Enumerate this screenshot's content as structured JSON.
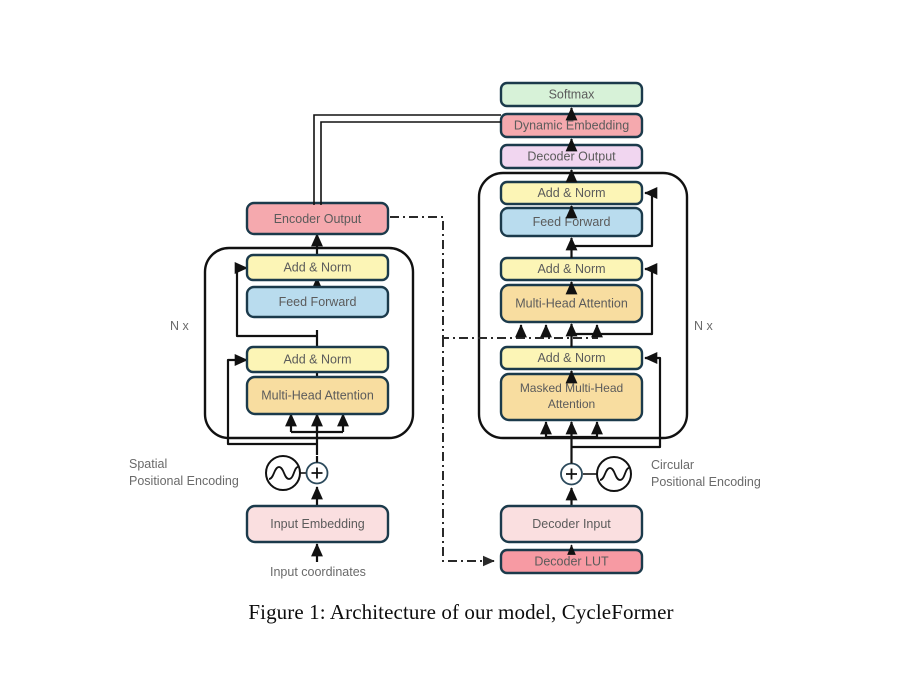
{
  "figure": {
    "caption": "Figure 1: Architecture of our model, CycleFormer"
  },
  "colors": {
    "softmax": "#d7f2d8",
    "dynamic_embedding": "#f5a9ae",
    "decoder_output": "#f1d6f0",
    "add_norm": "#fcf5b6",
    "feed_forward": "#b9dcee",
    "attention": "#f8dda0",
    "encoder_output": "#f5a9ae",
    "decoder_lut": "#f79aa3",
    "input_embedding": "#fadfe0",
    "decoder_input": "#fadfe0",
    "stroke": "#1b3a4b",
    "line": "#111111",
    "text": "#5b5b5b"
  },
  "encoder": {
    "output_label": "Encoder Output",
    "repeat_label": "N x",
    "add_norm_top_label": "Add & Norm",
    "feed_forward_label": "Feed Forward",
    "add_norm_bottom_label": "Add & Norm",
    "attention_label": "Multi-Head Attention",
    "positional_encoding_line1": "Spatial",
    "positional_encoding_line2": "Positional Encoding",
    "input_embedding_label": "Input Embedding",
    "input_caption": "Input coordinates"
  },
  "decoder": {
    "softmax_label": "Softmax",
    "dynamic_embedding_label": "Dynamic Embedding",
    "decoder_output_label": "Decoder Output",
    "repeat_label": "N x",
    "add_norm_top_label": "Add & Norm",
    "feed_forward_label": "Feed Forward",
    "add_norm_mid_label": "Add & Norm",
    "cross_attention_label": "Multi-Head Attention",
    "add_norm_bottom_label": "Add & Norm",
    "masked_attention_line1": "Masked Multi-Head",
    "masked_attention_line2": "Attention",
    "positional_encoding_line1": "Circular",
    "positional_encoding_line2": "Positional Encoding",
    "decoder_input_label": "Decoder Input",
    "decoder_lut_label": "Decoder LUT"
  }
}
